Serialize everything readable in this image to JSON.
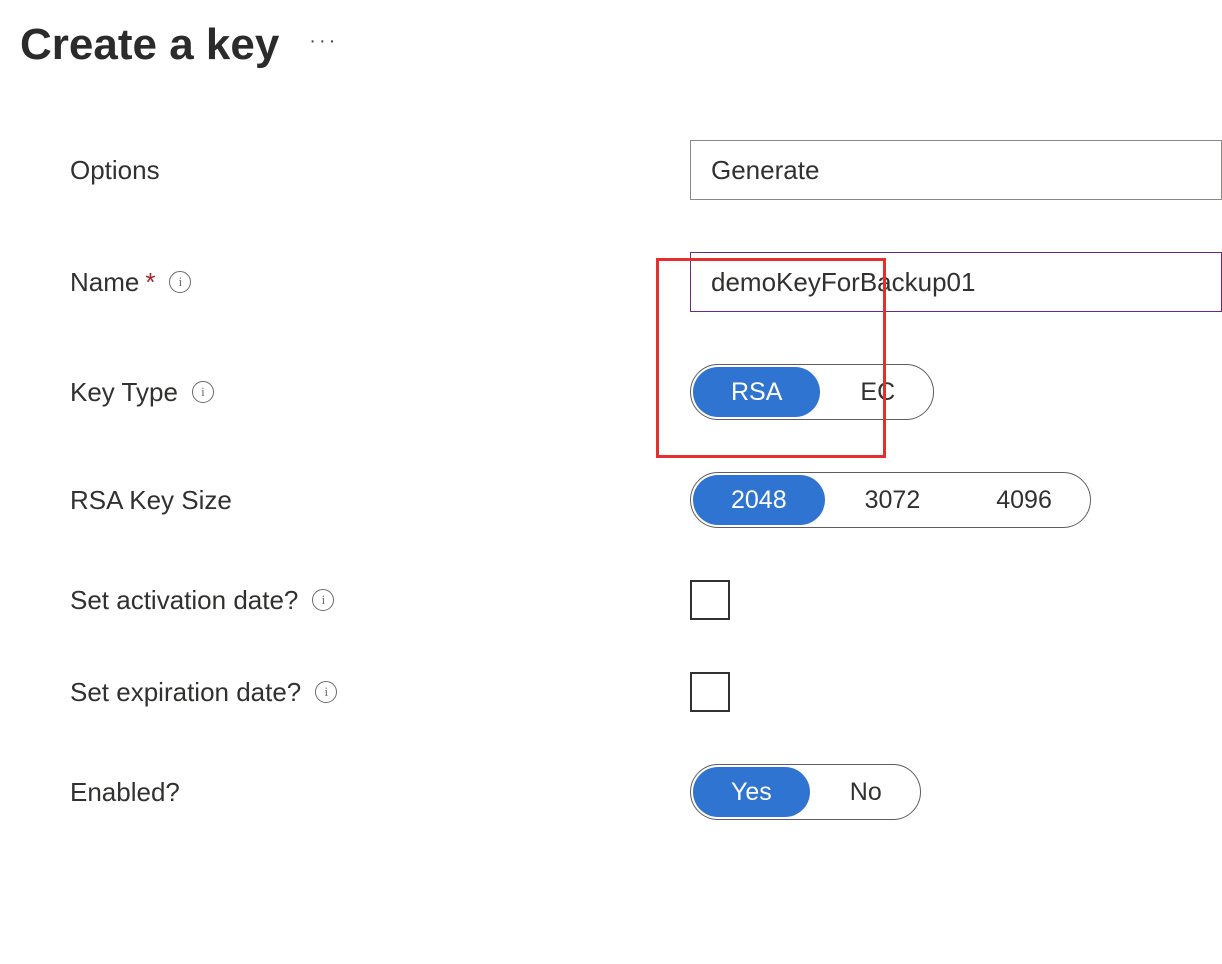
{
  "header": {
    "title": "Create a key"
  },
  "form": {
    "options": {
      "label": "Options",
      "value": "Generate"
    },
    "name": {
      "label": "Name",
      "value": "demoKeyForBackup01"
    },
    "keyType": {
      "label": "Key Type",
      "options": [
        "RSA",
        "EC"
      ],
      "selected": "RSA"
    },
    "rsaKeySize": {
      "label": "RSA Key Size",
      "options": [
        "2048",
        "3072",
        "4096"
      ],
      "selected": "2048"
    },
    "activationDate": {
      "label": "Set activation date?"
    },
    "expirationDate": {
      "label": "Set expiration date?"
    },
    "enabled": {
      "label": "Enabled?",
      "options": [
        "Yes",
        "No"
      ],
      "selected": "Yes"
    }
  }
}
